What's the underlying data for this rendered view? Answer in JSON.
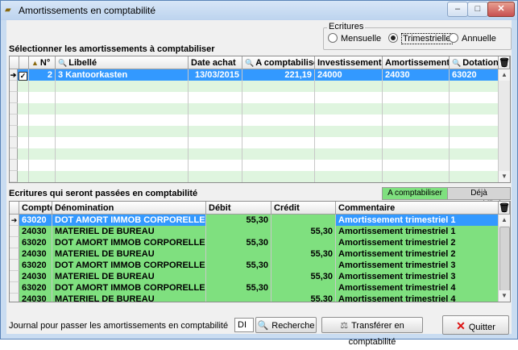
{
  "window": {
    "title": "Amortissements en comptabilité",
    "title_icon": "ledger-icon"
  },
  "ecritures": {
    "title": "Ecritures",
    "options": [
      "Mensuelle",
      "Trimestrielle",
      "Annuelle"
    ],
    "selected": "Trimestrielle"
  },
  "top_section_label": "Sélectionner les amortissements à comptabiliser",
  "top_grid": {
    "columns": [
      "N°",
      "Libellé",
      "Date achat",
      "A comptabiliser",
      "Investissement",
      "Amortissement",
      "Dotation"
    ],
    "rows": [
      {
        "checked": true,
        "num": "2",
        "libelle": "3 Kantoorkasten",
        "date": "13/03/2015",
        "a_comptabiliser": "221,19",
        "investissement": "24000",
        "amortissement": "24030",
        "dotation": "63020"
      }
    ]
  },
  "bottom_section_label": "Ecritures qui seront passées en comptabilité",
  "legend": {
    "a_comptabiliser": "A comptabiliser",
    "deja_comptabilise": "Déjà comptabilisé",
    "green": "#7fe07f",
    "gray": "#d4d4d4"
  },
  "bottom_grid": {
    "columns": [
      "Compte",
      "Dénomination",
      "Débit",
      "Crédit",
      "Commentaire"
    ],
    "rows": [
      {
        "compte": "63020",
        "denomination": "DOT AMORT IMMOB CORPORELLE",
        "debit": "55,30",
        "credit": "",
        "commentaire": "Amortissement trimestriel 1"
      },
      {
        "compte": "24030",
        "denomination": "MATERIEL DE BUREAU",
        "debit": "",
        "credit": "55,30",
        "commentaire": "Amortissement trimestriel 1"
      },
      {
        "compte": "63020",
        "denomination": "DOT AMORT IMMOB CORPORELLE",
        "debit": "55,30",
        "credit": "",
        "commentaire": "Amortissement trimestriel 2"
      },
      {
        "compte": "24030",
        "denomination": "MATERIEL DE BUREAU",
        "debit": "",
        "credit": "55,30",
        "commentaire": "Amortissement trimestriel 2"
      },
      {
        "compte": "63020",
        "denomination": "DOT AMORT IMMOB CORPORELLE",
        "debit": "55,30",
        "credit": "",
        "commentaire": "Amortissement trimestriel 3"
      },
      {
        "compte": "24030",
        "denomination": "MATERIEL DE BUREAU",
        "debit": "",
        "credit": "55,30",
        "commentaire": "Amortissement trimestriel 3"
      },
      {
        "compte": "63020",
        "denomination": "DOT AMORT IMMOB CORPORELLE",
        "debit": "55,30",
        "credit": "",
        "commentaire": "Amortissement trimestriel 4"
      },
      {
        "compte": "24030",
        "denomination": "MATERIEL DE BUREAU",
        "debit": "",
        "credit": "55,30",
        "commentaire": "Amortissement trimestriel 4"
      }
    ]
  },
  "footer": {
    "journal_label": "Journal pour passer les amortissements en comptabilité",
    "journal_value": "DI",
    "recherche_label": "Recherche",
    "transferer_label": "Transférer en comptabilité",
    "quitter_label": "Quitter"
  },
  "colors": {
    "accent": "#3399ff",
    "green_row": "#7fe07f",
    "stripe": "#dff5df"
  }
}
